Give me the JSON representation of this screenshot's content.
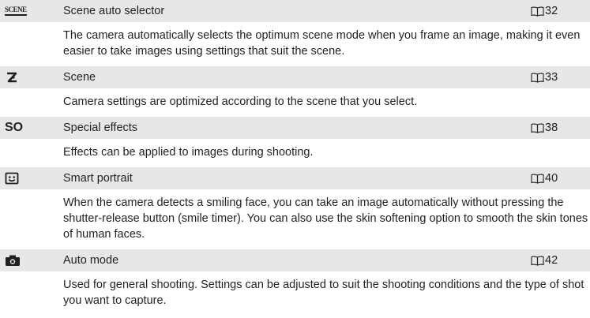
{
  "rows": [
    {
      "icon": "scene-auto-selector-icon",
      "icon_text": "SCENE",
      "name": "Scene auto selector",
      "page": "32",
      "description": "The camera automatically selects the optimum scene mode when you frame an image, making it even easier to take images using settings that suit the scene."
    },
    {
      "icon": "scene-icon",
      "name": "Scene",
      "page": "33",
      "description": "Camera settings are optimized according to the scene that you select."
    },
    {
      "icon": "special-effects-icon",
      "icon_text": "SO",
      "name": "Special effects",
      "page": "38",
      "description": "Effects can be applied to images during shooting."
    },
    {
      "icon": "smart-portrait-icon",
      "name": "Smart portrait",
      "page": "40",
      "description": "When the camera detects a smiling face, you can take an image automatically without pressing the shutter-release button (smile timer). You can also use the skin softening option to smooth the skin tones of human faces."
    },
    {
      "icon": "camera-icon",
      "name": "Auto mode",
      "page": "42",
      "description": "Used for general shooting. Settings can be adjusted to suit the shooting conditions and the type of shot you want to capture."
    }
  ],
  "colors": {
    "header_bg": "#e6e7e8",
    "text": "#231f20"
  }
}
